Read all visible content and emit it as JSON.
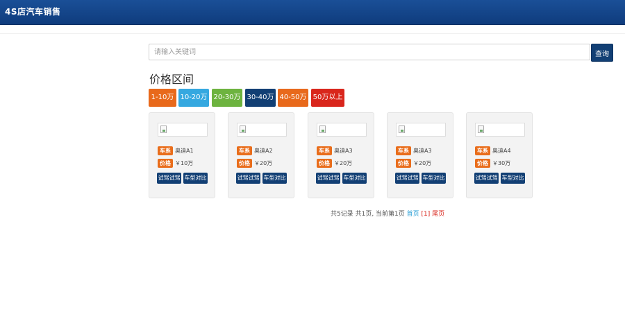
{
  "header": {
    "brand": "4S店汽车销售"
  },
  "search": {
    "placeholder": "请输入关键词",
    "button_label": "查询"
  },
  "price_section": {
    "title": "价格区间"
  },
  "filters": [
    {
      "label": "1-10万",
      "color": "#e8691b"
    },
    {
      "label": "10-20万",
      "color": "#35a8e0"
    },
    {
      "label": "20-30万",
      "color": "#6db33f"
    },
    {
      "label": "30-40万",
      "color": "#123f74"
    },
    {
      "label": "40-50万",
      "color": "#e8691b"
    },
    {
      "label": "50万以上",
      "color": "#d9261c"
    }
  ],
  "cards": [
    {
      "series_tag": "车系",
      "series": "奥迪A1",
      "price_tag": "价格",
      "price": "￥10万",
      "btn_test": "试驾试驾",
      "btn_compare": "车型对比"
    },
    {
      "series_tag": "车系",
      "series": "奥迪A2",
      "price_tag": "价格",
      "price": "￥20万",
      "btn_test": "试驾试驾",
      "btn_compare": "车型对比"
    },
    {
      "series_tag": "车系",
      "series": "奥迪A3",
      "price_tag": "价格",
      "price": "￥20万",
      "btn_test": "试驾试驾",
      "btn_compare": "车型对比"
    },
    {
      "series_tag": "车系",
      "series": "奥迪A3",
      "price_tag": "价格",
      "price": "￥20万",
      "btn_test": "试驾试驾",
      "btn_compare": "车型对比"
    },
    {
      "series_tag": "车系",
      "series": "奥迪A4",
      "price_tag": "价格",
      "price": "￥30万",
      "btn_test": "试驾试驾",
      "btn_compare": "车型对比"
    }
  ],
  "pagination": {
    "summary": "共5记录 共1页, 当前第1页",
    "first": "首页",
    "current": "[1]",
    "last": "尾页"
  }
}
